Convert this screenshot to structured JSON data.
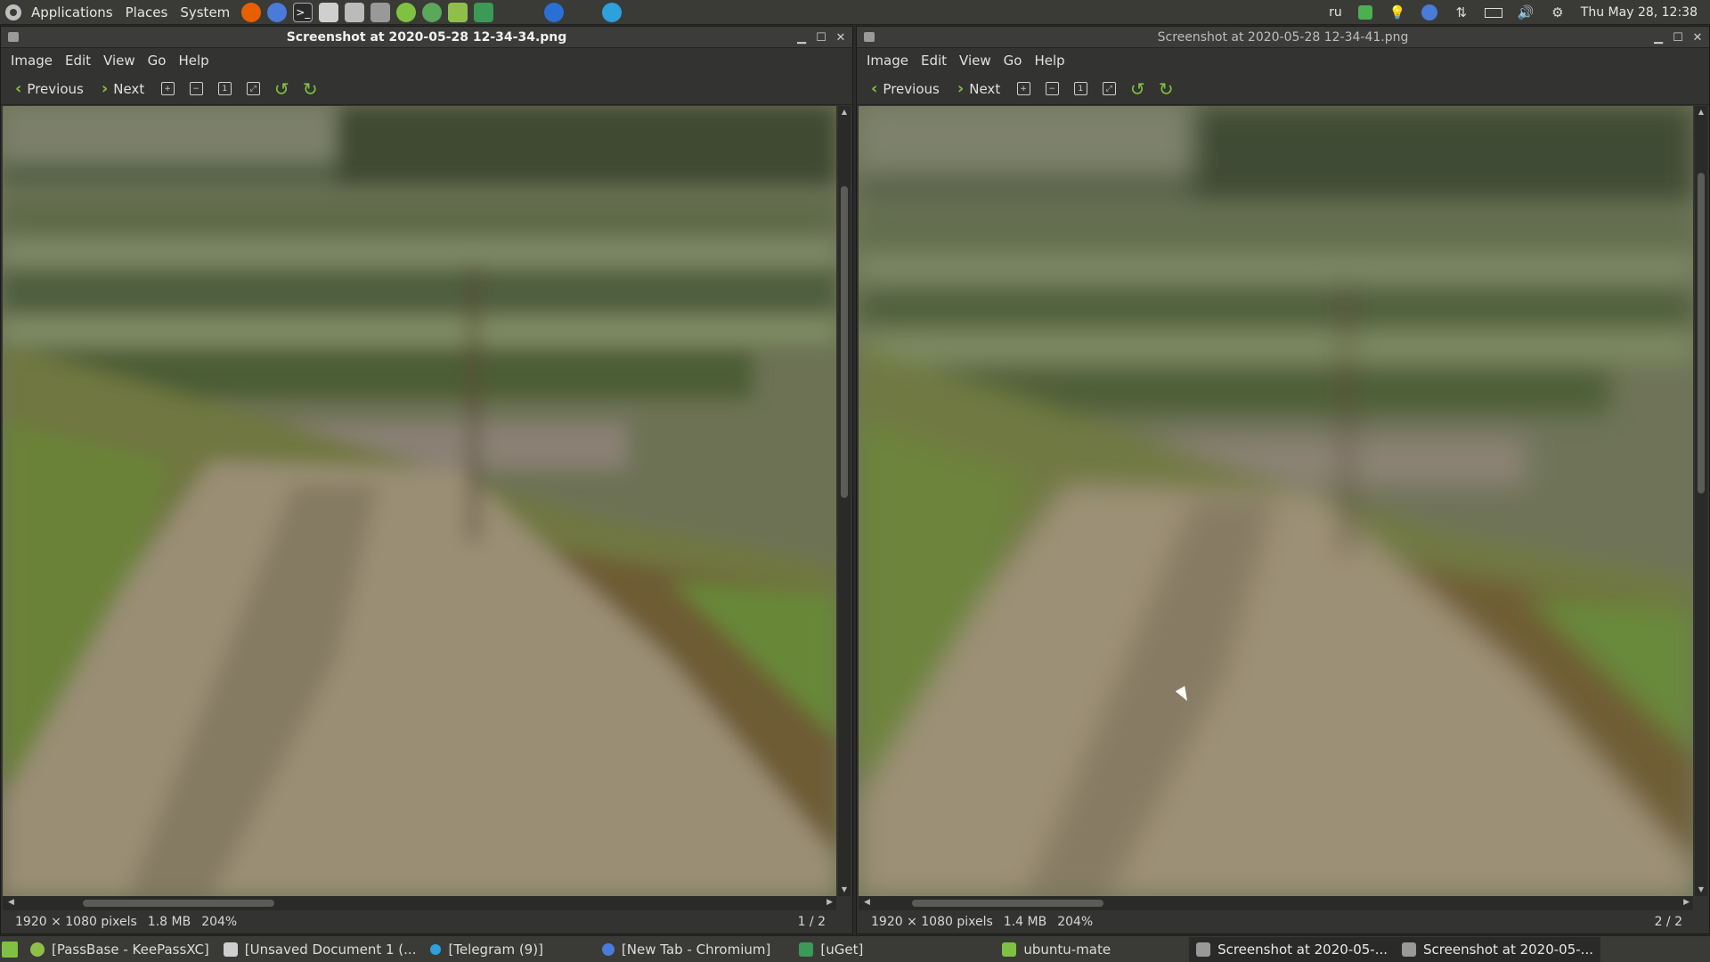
{
  "top_panel": {
    "menus": [
      "Applications",
      "Places",
      "System"
    ],
    "launchers": [
      {
        "icon": "firefox-icon",
        "color": "#e66000"
      },
      {
        "icon": "chromium-icon",
        "color": "#4a7bd8"
      },
      {
        "icon": "terminal-icon",
        "color": "#2b2b2b"
      },
      {
        "icon": "text-editor-icon",
        "color": "#cfcfcf"
      },
      {
        "icon": "calculator-icon",
        "color": "#bbbbbb"
      },
      {
        "icon": "disk-icon",
        "color": "#999999"
      },
      {
        "icon": "ubuntu-tweak-icon",
        "color": "#7fc241"
      },
      {
        "icon": "vpn-icon",
        "color": "#5ba75b"
      },
      {
        "icon": "keepass-icon",
        "color": "#8fbf4a"
      },
      {
        "icon": "uget-icon",
        "color": "#3b9a55"
      },
      {
        "icon": "teamviewer-icon",
        "color": "#2a6fd3"
      },
      {
        "icon": "telegram-icon",
        "color": "#2ea0dc"
      }
    ],
    "tray": {
      "keyboard_layout": "ru",
      "datetime": "Thu May 28, 12:38"
    }
  },
  "windows": [
    {
      "title": "Screenshot at 2020-05-28 12-34-34.png",
      "menu": [
        "Image",
        "Edit",
        "View",
        "Go",
        "Help"
      ],
      "toolbar": {
        "previous": "Previous",
        "next": "Next"
      },
      "status": {
        "dimensions": "1920 × 1080 pixels",
        "size": "1.8 MB",
        "zoom": "204%",
        "page": "1 / 2"
      }
    },
    {
      "title": "Screenshot at 2020-05-28 12-34-41.png",
      "menu": [
        "Image",
        "Edit",
        "View",
        "Go",
        "Help"
      ],
      "toolbar": {
        "previous": "Previous",
        "next": "Next"
      },
      "status": {
        "dimensions": "1920 × 1080 pixels",
        "size": "1.4 MB",
        "zoom": "204%",
        "page": "2 / 2"
      }
    }
  ],
  "taskbar": [
    {
      "label": "[PassBase - KeePassXC]",
      "icon": "keepass-icon",
      "color": "#8fbf4a"
    },
    {
      "label": "[Unsaved Document 1 (...",
      "icon": "text-editor-icon",
      "color": "#cfcfcf"
    },
    {
      "label": "[Telegram (9)]",
      "icon": "telegram-icon",
      "color": "#2ea0dc"
    },
    {
      "label": "[New Tab - Chromium]",
      "icon": "chromium-icon",
      "color": "#4a7bd8"
    },
    {
      "label": "[uGet]",
      "icon": "uget-icon",
      "color": "#3b9a55"
    },
    {
      "label": "ubuntu-mate",
      "icon": "folder-icon",
      "color": "#7fc241"
    },
    {
      "label": "Screenshot at 2020-05-...",
      "icon": "image-viewer-icon",
      "color": "#999999"
    },
    {
      "label": "Screenshot at 2020-05-...",
      "icon": "image-viewer-icon",
      "color": "#999999"
    }
  ]
}
